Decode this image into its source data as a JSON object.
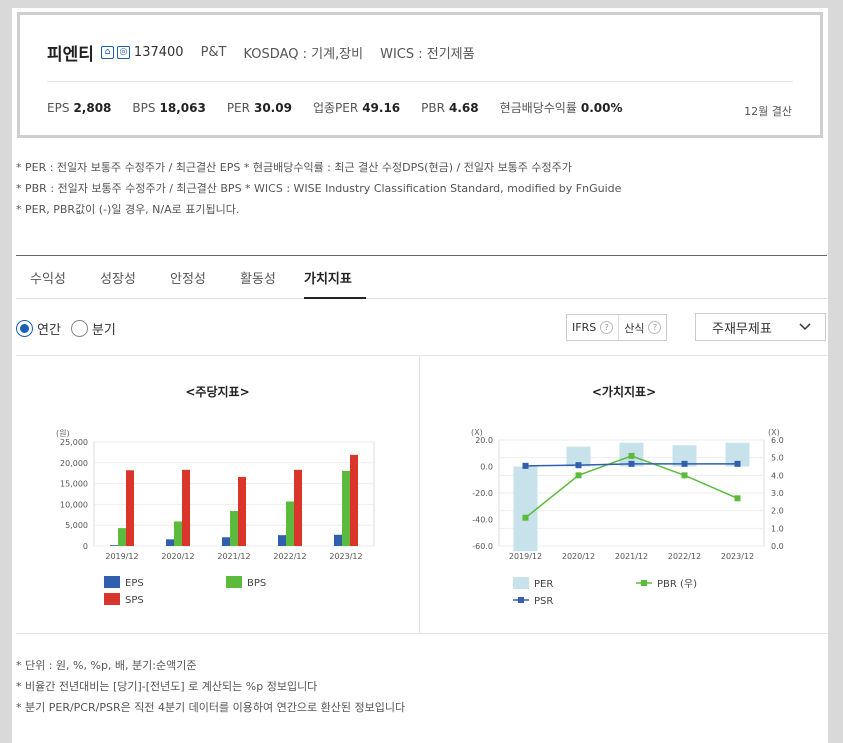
{
  "header": {
    "corp_name": "피엔티",
    "icon1": "home-icon",
    "icon2": "ir-icon",
    "code": "137400",
    "group": "P&T",
    "market": "KOSDAQ : 기계,장비",
    "wics": "WICS : 전기제품",
    "metrics": [
      {
        "label": "EPS",
        "value": "2,808"
      },
      {
        "label": "BPS",
        "value": "18,063"
      },
      {
        "label": "PER",
        "value": "30.09"
      },
      {
        "label": "업종PER",
        "value": "49.16"
      },
      {
        "label": "PBR",
        "value": "4.68"
      },
      {
        "label": "현금배당수익률",
        "value": "0.00%"
      }
    ],
    "settlement": "12월 결산"
  },
  "notes": [
    "* PER : 전일자 보통주 수정주가 / 최근결산 EPS * 현금배당수익률 : 최근 결산 수정DPS(현금) / 전일자 보통주 수정주가",
    "* PBR : 전일자 보통주 수정주가 / 최근결산 BPS * WICS : WISE Industry Classification Standard, modified by FnGuide",
    "* PER, PBR값이 (-)일 경우, N/A로 표기됩니다."
  ],
  "tabs": [
    "수익성",
    "성장성",
    "안정성",
    "활동성",
    "가치지표"
  ],
  "active_tab": "가치지표",
  "period": {
    "annual": "연간",
    "quarter": "분기",
    "selected": "연간"
  },
  "buttons": {
    "ifrs": "IFRS",
    "formula": "산식",
    "help": "?"
  },
  "select_value": "주재무제표",
  "chart_data": [
    {
      "type": "bar",
      "title": "<주당지표>",
      "ylabel": "(원)",
      "categories": [
        "2019/12",
        "2020/12",
        "2021/12",
        "2022/12",
        "2023/12"
      ],
      "ylim": [
        0,
        25000
      ],
      "yticks": [
        "25,000",
        "20,000",
        "15,000",
        "10,000",
        "5,000",
        "0"
      ],
      "series": [
        {
          "name": "EPS",
          "color": "#2f5fad",
          "values": [
            200,
            1600,
            2100,
            2600,
            2700
          ]
        },
        {
          "name": "BPS",
          "color": "#5cba3c",
          "values": [
            4300,
            5900,
            8400,
            10700,
            18063
          ]
        },
        {
          "name": "SPS",
          "color": "#d9352a",
          "values": [
            18200,
            18300,
            16600,
            18300,
            21900
          ]
        }
      ]
    },
    {
      "type": "bar",
      "title": "<가치지표>",
      "ylabel_left": "(X)",
      "ylabel_right": "(X)",
      "categories": [
        "2019/12",
        "2020/12",
        "2021/12",
        "2022/12",
        "2023/12"
      ],
      "ylim_left": [
        -60,
        20
      ],
      "ylim_right": [
        0,
        6
      ],
      "yticks_left": [
        "20.0",
        "0.0",
        "-20.0",
        "-40.0",
        "-60.0"
      ],
      "yticks_right": [
        "6.0",
        "5.0",
        "4.0",
        "3.0",
        "2.0",
        "1.0",
        "0.0"
      ],
      "series": [
        {
          "name": "PER",
          "color": "#c7e2ea",
          "axis": "left",
          "kind": "bar",
          "values": [
            -64,
            15,
            18,
            16,
            18
          ]
        },
        {
          "name": "PBR (우)",
          "color": "#5cba3c",
          "axis": "right",
          "kind": "line",
          "values": [
            1.6,
            4.0,
            5.1,
            4.0,
            2.7
          ]
        },
        {
          "name": "PSR",
          "color": "#2f5fad",
          "axis": "left",
          "kind": "line",
          "values": [
            0.5,
            1.0,
            2.0,
            2.0,
            2.0
          ]
        }
      ]
    }
  ],
  "bottom_notes": [
    "* 단위 : 원, %, %p, 배, 분기:순액기준",
    "* 비율간 전년대비는 [당기]-[전년도] 로 계산되는 %p 정보입니다",
    "* 분기 PER/PCR/PSR은 직전 4분기 데이터를 이용하여 연간으로 환산된 정보입니다"
  ]
}
